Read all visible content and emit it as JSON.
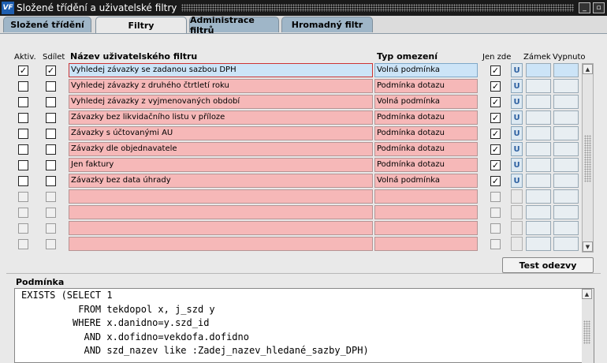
{
  "window": {
    "title": "Složené třídění a uživatelské filtry",
    "app_icon": "VF",
    "minimize_glyph": "_",
    "maximize_glyph": "▫"
  },
  "tabs": [
    {
      "label": "Složené třídění"
    },
    {
      "label": "Filtry"
    },
    {
      "label": "Administrace filtrů"
    },
    {
      "label": "Hromadný filtr"
    }
  ],
  "grid": {
    "headers": {
      "active": "Aktiv.",
      "share": "Sdílet",
      "name": "Název uživatelského filtru",
      "type": "Typ omezení",
      "here_only": "Jen zde",
      "lock": "Zámek",
      "off": "Vypnuto"
    },
    "u_label": "U",
    "check_glyph": "✓",
    "rows": [
      {
        "active": true,
        "share": true,
        "name": "Vyhledej závazky se zadanou sazbou DPH",
        "type": "Volná podmínka",
        "here_only": true
      },
      {
        "active": false,
        "share": false,
        "name": "Vyhledej závazky z druhého čtrtletí roku",
        "type": "Podmínka dotazu",
        "here_only": true
      },
      {
        "active": false,
        "share": false,
        "name": "Vyhledej závazky z vyjmenovaných období",
        "type": "Volná podmínka",
        "here_only": true
      },
      {
        "active": false,
        "share": false,
        "name": "Závazky bez likvidačního listu v příloze",
        "type": "Podmínka dotazu",
        "here_only": true
      },
      {
        "active": false,
        "share": false,
        "name": "Závazky s účtovanými AU",
        "type": "Podmínka dotazu",
        "here_only": true
      },
      {
        "active": false,
        "share": false,
        "name": "Závazky dle objednavatele",
        "type": "Podmínka dotazu",
        "here_only": true
      },
      {
        "active": false,
        "share": false,
        "name": "Jen faktury",
        "type": "Podmínka dotazu",
        "here_only": true
      },
      {
        "active": false,
        "share": false,
        "name": "Závazky bez data úhrady",
        "type": "Volná podmínka",
        "here_only": true
      },
      {
        "active": false,
        "share": false,
        "name": "",
        "type": "",
        "here_only": false
      },
      {
        "active": false,
        "share": false,
        "name": "",
        "type": "",
        "here_only": false
      },
      {
        "active": false,
        "share": false,
        "name": "",
        "type": "",
        "here_only": false
      },
      {
        "active": false,
        "share": false,
        "name": "",
        "type": "",
        "here_only": false
      }
    ]
  },
  "test_button": "Test odezvy",
  "condition": {
    "label": "Podmínka",
    "lines": [
      "EXISTS (SELECT 1",
      "          FROM tekdopol x, j_szd y",
      "         WHERE x.danidno=y.szd_id",
      "           AND x.dofidno=vekdofa.dofidno",
      "           AND szd_nazev like :Zadej_nazev_hledané_sazby_DPH)"
    ]
  },
  "icons": {
    "scroll_up": "up-arrow-icon",
    "scroll_down": "down-arrow-icon",
    "check": "check-icon",
    "app": "app-logo-icon"
  },
  "colors": {
    "row_fill": "#f6b8b8",
    "selected_fill": "#cce4f7",
    "tab_inactive": "#9fb6c8",
    "titlebar": "#1a1a1a"
  }
}
